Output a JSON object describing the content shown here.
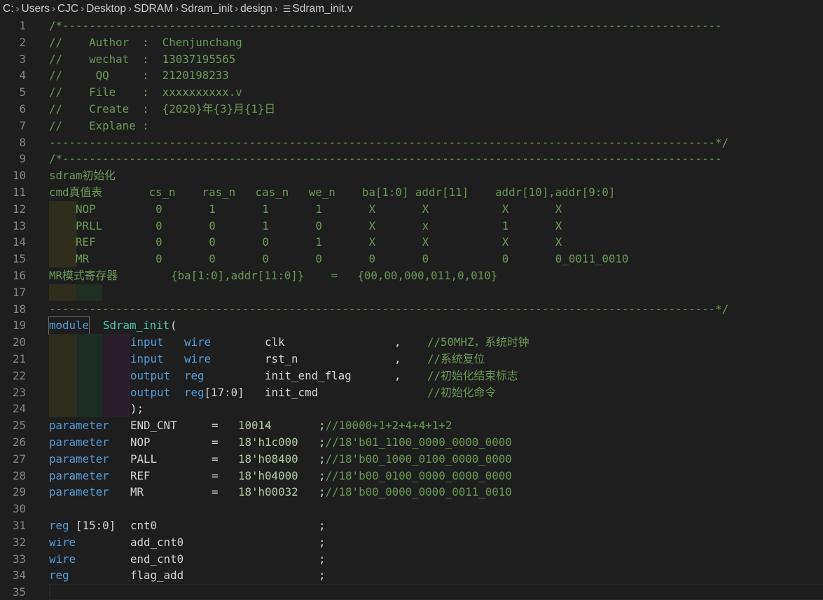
{
  "breadcrumb": {
    "items": [
      "C:",
      "Users",
      "CJC",
      "Desktop",
      "SDRAM",
      "Sdram_init",
      "design"
    ],
    "file": "Sdram_init.v",
    "file_icon": "lines-file-icon"
  },
  "lines": [
    {
      "n": "1",
      "t": "/*---------------------------------------------------------------------------------------------------"
    },
    {
      "n": "2",
      "t": "//    Author  :  Chenjunchang"
    },
    {
      "n": "3",
      "t": "//    wechat  :  13037195565"
    },
    {
      "n": "4",
      "t": "//     QQ     :  2120198233"
    },
    {
      "n": "5",
      "t": "//    File    :  xxxxxxxxxx.v"
    },
    {
      "n": "6",
      "t": "//    Create  :  {2020}年{3}月{1}日"
    },
    {
      "n": "7",
      "t": "//    Explane :"
    },
    {
      "n": "8",
      "t": "----------------------------------------------------------------------------------------------------*/"
    },
    {
      "n": "9",
      "t": "/*---------------------------------------------------------------------------------------------------"
    },
    {
      "n": "10",
      "t": "sdram初始化"
    },
    {
      "n": "11",
      "t": "cmd真值表       cs_n    ras_n   cas_n   we_n    ba[1:0] addr[11]    addr[10],addr[9:0]"
    },
    {
      "n": "12",
      "t": "    NOP         0       1       1       1       X       X           X       X"
    },
    {
      "n": "13",
      "t": "    PRLL        0       0       1       0       X       x           1       X"
    },
    {
      "n": "14",
      "t": "    REF         0       0       0       1       X       X           X       X"
    },
    {
      "n": "15",
      "t": "    MR          0       0       0       0       0       0           0       0_0011_0010"
    },
    {
      "n": "16",
      "t": "MR模式寄存器        {ba[1:0],addr[11:0]}    =   {00,00,000,011,0,010}"
    },
    {
      "n": "17",
      "t": ""
    },
    {
      "n": "18",
      "t": "----------------------------------------------------------------------------------------------------*/"
    },
    {
      "n": "19",
      "kw": "module",
      "name": "Sdram_init",
      "rest": "("
    },
    {
      "n": "20",
      "a": "input",
      "b": "wire",
      "c": "clk",
      "d": ",",
      "e": "//50MHZ，系统时钟"
    },
    {
      "n": "21",
      "a": "input",
      "b": "wire",
      "c": "rst_n",
      "d": ",",
      "e": "//系统复位"
    },
    {
      "n": "22",
      "a": "output",
      "b": "reg",
      "c": "init_end_flag",
      "d": ",",
      "e": "//初始化结束标志"
    },
    {
      "n": "23",
      "a": "output",
      "b": "reg[17:0]",
      "c": "init_cmd",
      "d": "",
      "e": "//初始化命令"
    },
    {
      "n": "24",
      "t": ");"
    },
    {
      "n": "25",
      "a": "parameter",
      "b": "END_CNT",
      "c": "=",
      "d": "10014",
      "e": ";//10000+1+2+4+4+1+2"
    },
    {
      "n": "26",
      "a": "parameter",
      "b": "NOP",
      "c": "=",
      "d": "18'h1c000",
      "e": ";//18'b01_1100_0000_0000_0000"
    },
    {
      "n": "27",
      "a": "parameter",
      "b": "PALL",
      "c": "=",
      "d": "18'h08400",
      "e": ";//18'b00_1000_0100_0000_0000"
    },
    {
      "n": "28",
      "a": "parameter",
      "b": "REF",
      "c": "=",
      "d": "18'h04000",
      "e": ";//18'b00_0100_0000_0000_0000"
    },
    {
      "n": "29",
      "a": "parameter",
      "b": "MR",
      "c": "=",
      "d": "18'h00032",
      "e": ";//18'b00_0000_0000_0011_0010"
    },
    {
      "n": "30",
      "t": ""
    },
    {
      "n": "31",
      "a": "reg [15:0]",
      "b": "cnt0",
      "c": ";"
    },
    {
      "n": "32",
      "a": "wire",
      "b": "add_cnt0",
      "c": ";"
    },
    {
      "n": "33",
      "a": "wire",
      "b": "end_cnt0",
      "c": ";"
    },
    {
      "n": "34",
      "a": "reg",
      "b": "flag_add",
      "c": ";"
    },
    {
      "n": "35",
      "t": ""
    }
  ]
}
